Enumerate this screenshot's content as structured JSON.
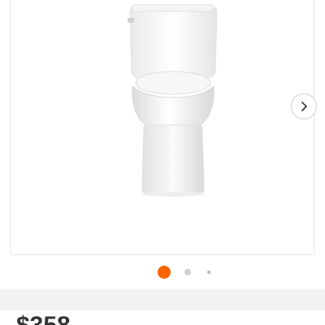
{
  "gallery": {
    "image_alt": "toilet",
    "next_icon": "chevron-right-icon",
    "dot_count": 3,
    "active_index": 0,
    "active_color": "#f96302"
  },
  "product": {
    "price_partial": "$358"
  }
}
